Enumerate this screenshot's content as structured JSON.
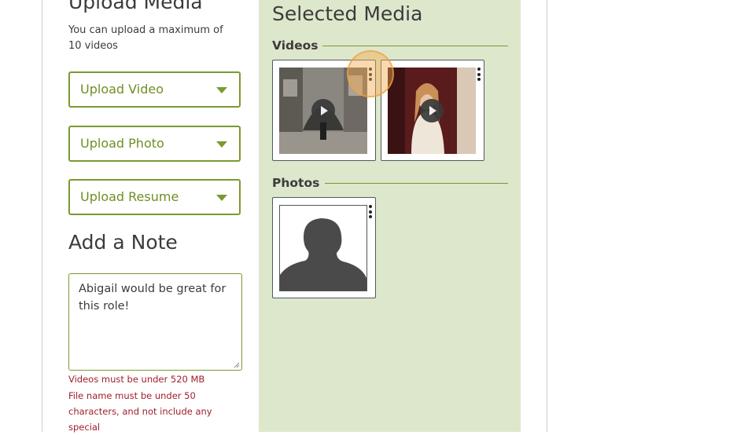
{
  "upload": {
    "title": "Upload Media",
    "hint": "You can upload a maximum of 10 videos",
    "video_label": "Upload Video",
    "photo_label": "Upload Photo",
    "resume_label": "Upload Resume"
  },
  "note": {
    "title": "Add a Note",
    "value": "Abigail would be great for this role!",
    "errors": [
      "Videos must be under 520 MB",
      "File name must be under 50 characters, and not include any special"
    ]
  },
  "selected": {
    "title": "Selected Media",
    "videos_label": "Videos",
    "photos_label": "Photos",
    "videos": [
      {
        "icon": "play-icon",
        "menu_icon": "kebab-menu-icon"
      },
      {
        "icon": "play-icon",
        "menu_icon": "kebab-menu-icon"
      }
    ],
    "photos": [
      {
        "icon": "person-silhouette-icon",
        "menu_icon": "kebab-menu-icon"
      }
    ]
  },
  "colors": {
    "accent": "#7a9a2e",
    "selected_bg": "#dde7cc",
    "error": "#a0202c"
  }
}
